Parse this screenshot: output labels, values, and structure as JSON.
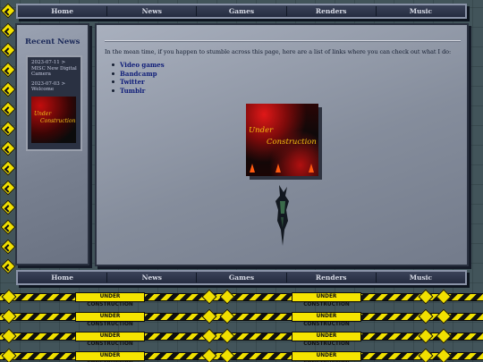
{
  "nav": {
    "items": [
      {
        "label": "Home"
      },
      {
        "label": "News"
      },
      {
        "label": "Games"
      },
      {
        "label": "Renders"
      },
      {
        "label": "Music"
      }
    ]
  },
  "sidebar": {
    "title": "Recent News",
    "news": [
      {
        "label": "2023-07-11 > MISC New Digital Camera"
      },
      {
        "label": "2023-07-03 > Welcome"
      }
    ],
    "thumb_line1": "Under",
    "thumb_line2": "Construction"
  },
  "main": {
    "intro": "In the mean time, if you happen to stumble across this page, here are a list of links where you can check out what I do:",
    "links": [
      {
        "label": "Video games"
      },
      {
        "label": "Bandcamp"
      },
      {
        "label": "Twitter"
      },
      {
        "label": "Tumblr"
      }
    ],
    "banner_line1": "Under",
    "banner_line2": "Construction"
  },
  "tape": {
    "label": "UNDER CONSTRUCTION"
  },
  "colors": {
    "caution_yellow": "#f1e000",
    "nav_bg": "#2f364c",
    "link_blue": "#12207a",
    "title_blue": "#1a2858"
  }
}
